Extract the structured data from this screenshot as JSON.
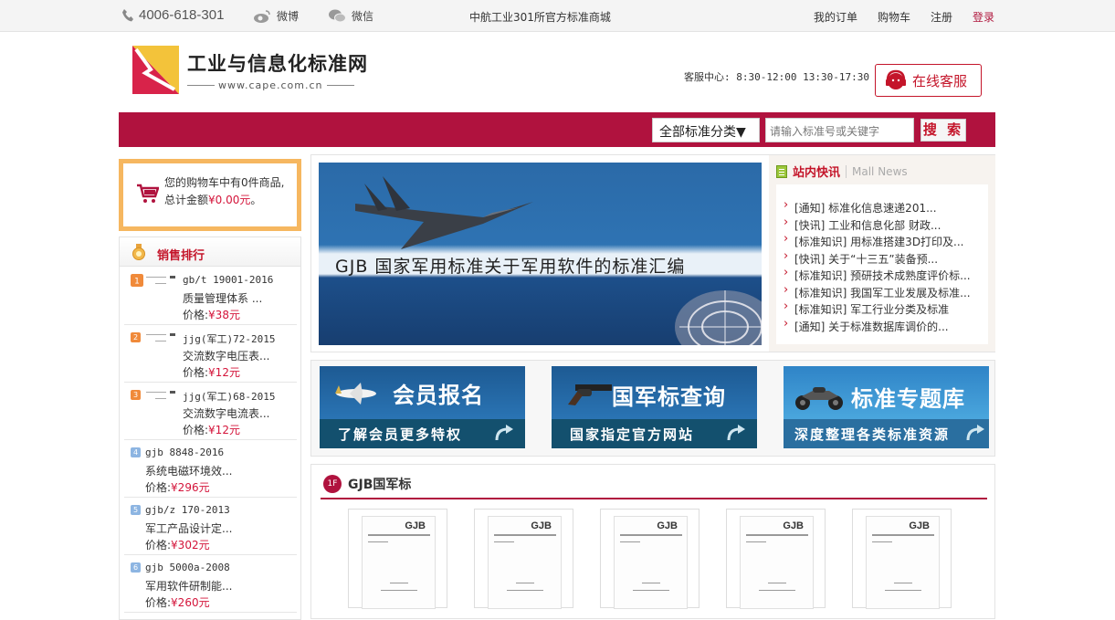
{
  "topbar": {
    "phone": "4006-618-301",
    "weibo": "微博",
    "weixin": "微信",
    "slogan": "中航工业301所官方标准商城",
    "links": {
      "orders": "我的订单",
      "cart": "购物车",
      "register": "注册",
      "login": "登录"
    }
  },
  "header": {
    "logo_title": "工业与信息化标准网",
    "logo_url": "www.cape.com.cn",
    "service_hours": "客服中心: 8:30-12:00 13:30-17:30",
    "online_service": "在线客服"
  },
  "search": {
    "category": "全部标准分类▼",
    "placeholder": "请输入标准号或关键字",
    "button": "搜 索"
  },
  "cart": {
    "line1": "您的购物车中有0件商品,",
    "line2_prefix": "总计金额",
    "amount": "¥0.00元",
    "line2_suffix": "。"
  },
  "ranking": {
    "title": "销售排行",
    "items": [
      {
        "rank": "1",
        "code": "gb/t 19001-2016",
        "name": "质量管理体系 ...",
        "price_label": "价格:",
        "price": "¥38元"
      },
      {
        "rank": "2",
        "code": "jjg(军工)72-2015",
        "name": "交流数字电压表...",
        "price_label": "价格:",
        "price": "¥12元"
      },
      {
        "rank": "3",
        "code": "jjg(军工)68-2015",
        "name": "交流数字电流表...",
        "price_label": "价格:",
        "price": "¥12元"
      },
      {
        "rank": "4",
        "code": "gjb 8848-2016",
        "name": "系统电磁环境效...",
        "price_label": "价格:",
        "price": "¥296元"
      },
      {
        "rank": "5",
        "code": "gjb/z 170-2013",
        "name": "军工产品设计定...",
        "price_label": "价格:",
        "price": "¥302元"
      },
      {
        "rank": "6",
        "code": "gjb 5000a-2008",
        "name": "军用软件研制能...",
        "price_label": "价格:",
        "price": "¥260元"
      }
    ]
  },
  "banner": {
    "caption": "GJB 国家军用标准关于军用软件的标准汇编"
  },
  "news": {
    "title": "站内快讯",
    "subtitle": "Mall News",
    "items": [
      "[通知] 标准化信息速递201...",
      "[快讯] 工业和信息化部 财政...",
      "[标准知识] 用标准搭建3D打印及...",
      "[快讯] 关于“十三五”装备预...",
      "[标准知识] 预研技术成熟度评价标...",
      "[标准知识] 我国军工业发展及标准...",
      "[标准知识] 军工行业分类及标准",
      "[通知] 关于标准数据库调价的..."
    ]
  },
  "promos": [
    {
      "title": "会员报名",
      "sub": "了解会员更多特权"
    },
    {
      "title": "国军标查询",
      "sub": "国家指定官方网站"
    },
    {
      "title": "标准专题库",
      "sub": "深度整理各类标准资源"
    }
  ],
  "gjb_section": {
    "badge": "1F",
    "title": "GJB国军标",
    "book_label": "GJB"
  },
  "colors": {
    "brand_red": "#b0123e",
    "price_red": "#d4143a",
    "cart_border": "#f6b760",
    "promo_dark": "#13506e"
  }
}
